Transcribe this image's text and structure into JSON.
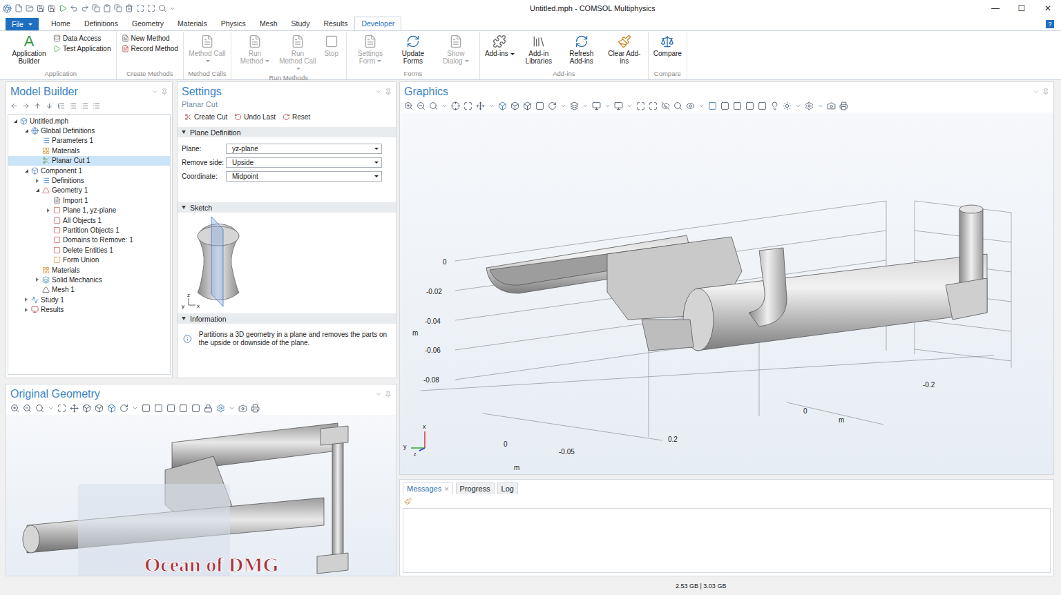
{
  "window": {
    "title": "Untitled.mph - COMSOL Multiphysics",
    "controls": [
      "—",
      "☐",
      "✕"
    ]
  },
  "ribbon_tabs": [
    {
      "label": "File",
      "kind": "menu",
      "selected": false
    },
    {
      "label": "Home",
      "kind": "tab",
      "selected": false
    },
    {
      "label": "Definitions",
      "kind": "tab",
      "selected": false
    },
    {
      "label": "Geometry",
      "kind": "tab",
      "selected": false
    },
    {
      "label": "Materials",
      "kind": "tab",
      "selected": false
    },
    {
      "label": "Physics",
      "kind": "tab",
      "selected": false
    },
    {
      "label": "Mesh",
      "kind": "tab",
      "selected": false
    },
    {
      "label": "Study",
      "kind": "tab",
      "selected": false
    },
    {
      "label": "Results",
      "kind": "tab",
      "selected": false
    },
    {
      "label": "Developer",
      "kind": "tab",
      "selected": true
    }
  ],
  "help": "?",
  "ribbon_groups": [
    {
      "label": "Application",
      "items": [
        {
          "label": "Application Builder",
          "kind": "large",
          "glyph": "A",
          "disabled": false,
          "dropdown": false
        },
        {
          "label": "Data Access",
          "kind": "small",
          "disabled": false,
          "dropdown": false
        },
        {
          "label": "Test Application",
          "kind": "small",
          "disabled": false,
          "dropdown": false
        }
      ]
    },
    {
      "label": "Create Methods",
      "items": [
        {
          "label": "New Method",
          "kind": "small",
          "disabled": false,
          "dropdown": false
        },
        {
          "label": "Record Method",
          "kind": "small",
          "disabled": false,
          "dropdown": false
        }
      ]
    },
    {
      "label": "Method Calls",
      "items": [
        {
          "label": "Method Call",
          "kind": "large",
          "disabled": true,
          "dropdown": true
        }
      ]
    },
    {
      "label": "Run Methods",
      "items": [
        {
          "label": "Run Method",
          "kind": "large",
          "disabled": true,
          "dropdown": true
        },
        {
          "label": "Run Method Call",
          "kind": "large",
          "disabled": true,
          "dropdown": true
        },
        {
          "label": "Stop",
          "kind": "large",
          "disabled": true,
          "dropdown": false
        }
      ]
    },
    {
      "label": "Forms",
      "items": [
        {
          "label": "Settings Form",
          "kind": "large",
          "disabled": true,
          "dropdown": true
        },
        {
          "label": "Update Forms",
          "kind": "large",
          "disabled": false,
          "dropdown": false
        },
        {
          "label": "Show Dialog",
          "kind": "large",
          "disabled": true,
          "dropdown": true
        }
      ]
    },
    {
      "label": "Add-ins",
      "items": [
        {
          "label": "Add-ins",
          "kind": "large",
          "disabled": false,
          "dropdown": true
        },
        {
          "label": "Add-in Libraries",
          "kind": "large",
          "disabled": false,
          "dropdown": false
        },
        {
          "label": "Refresh Add-ins",
          "kind": "large",
          "disabled": false,
          "dropdown": false
        },
        {
          "label": "Clear Add-ins",
          "kind": "large",
          "disabled": false,
          "dropdown": false
        }
      ]
    },
    {
      "label": "Compare",
      "items": [
        {
          "label": "Compare",
          "kind": "large",
          "disabled": false,
          "dropdown": false
        }
      ]
    }
  ],
  "model_builder": {
    "title": "Model Builder",
    "tree": [
      {
        "label": "Untitled.mph",
        "level": 0,
        "kind": "expanded",
        "selected": false
      },
      {
        "label": "Global Definitions",
        "level": 1,
        "kind": "expanded",
        "selected": false
      },
      {
        "label": "Parameters 1",
        "level": 2,
        "kind": "leaf",
        "selected": false
      },
      {
        "label": "Materials",
        "level": 2,
        "kind": "leaf",
        "selected": false
      },
      {
        "label": "Planar Cut 1",
        "level": 2,
        "kind": "leaf",
        "selected": true
      },
      {
        "label": "Component 1",
        "level": 1,
        "kind": "expanded",
        "selected": false
      },
      {
        "label": "Definitions",
        "level": 2,
        "kind": "collapsed",
        "selected": false
      },
      {
        "label": "Geometry 1",
        "level": 2,
        "kind": "expanded",
        "selected": false
      },
      {
        "label": "Import 1",
        "level": 3,
        "kind": "leaf",
        "selected": false
      },
      {
        "label": "Plane 1, yz-plane",
        "level": 3,
        "kind": "collapsed",
        "selected": false
      },
      {
        "label": "All Objects 1",
        "level": 3,
        "kind": "leaf",
        "selected": false
      },
      {
        "label": "Partition Objects 1",
        "level": 3,
        "kind": "leaf",
        "selected": false
      },
      {
        "label": "Domains to Remove: 1",
        "level": 3,
        "kind": "leaf",
        "selected": false
      },
      {
        "label": "Delete Entities 1",
        "level": 3,
        "kind": "leaf",
        "selected": false
      },
      {
        "label": "Form Union",
        "level": 3,
        "kind": "leaf",
        "selected": false
      },
      {
        "label": "Materials",
        "level": 2,
        "kind": "leaf",
        "selected": false
      },
      {
        "label": "Solid Mechanics",
        "level": 2,
        "kind": "collapsed",
        "selected": false
      },
      {
        "label": "Mesh 1",
        "level": 2,
        "kind": "leaf",
        "selected": false
      },
      {
        "label": "Study 1",
        "level": 1,
        "kind": "collapsed",
        "selected": false
      },
      {
        "label": "Results",
        "level": 1,
        "kind": "collapsed",
        "selected": false
      }
    ]
  },
  "settings": {
    "title": "Settings",
    "subtitle": "Planar Cut",
    "actions": [
      "Create Cut",
      "Undo Last",
      "Reset"
    ],
    "plane_definition": {
      "title": "Plane Definition",
      "expanded": true,
      "fields": [
        {
          "label": "Plane:",
          "value": "yz-plane"
        },
        {
          "label": "Remove side:",
          "value": "Upside"
        },
        {
          "label": "Coordinate:",
          "value": "Midpoint"
        }
      ]
    },
    "sketch": {
      "title": "Sketch",
      "expanded": true,
      "axes": [
        "z",
        "y",
        "x"
      ]
    },
    "information": {
      "title": "Information",
      "expanded": true,
      "text": "Partitions a 3D geometry in a plane and removes the parts on the upside or downside of the plane."
    }
  },
  "graphics": {
    "title": "Graphics",
    "axis_labels": [
      "0",
      "-0.02",
      "-0.04",
      "-0.06",
      "-0.08",
      "m",
      "-0.2",
      "0",
      "m",
      "0.2",
      "0",
      "-0.05",
      "m"
    ],
    "triad": [
      "x",
      "y",
      "z"
    ]
  },
  "messages": {
    "tabs": [
      {
        "label": "Messages",
        "selected": true,
        "closable": true
      },
      {
        "label": "Progress",
        "selected": false,
        "closable": false
      },
      {
        "label": "Log",
        "selected": false,
        "closable": false
      }
    ],
    "close": "×"
  },
  "original_geometry": {
    "title": "Original Geometry",
    "watermark": "Ocean of DMG"
  },
  "status_bar": {
    "memory": "2.53 GB | 3.03 GB"
  }
}
